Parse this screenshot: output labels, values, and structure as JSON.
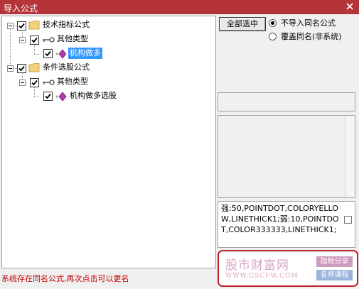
{
  "window": {
    "title": "导入公式"
  },
  "tree": {
    "items": [
      {
        "label": "技术指标公式"
      },
      {
        "label": "其他类型"
      },
      {
        "label": "机构做多"
      },
      {
        "label": "条件选股公式"
      },
      {
        "label": "其他类型"
      },
      {
        "label": "机构做多选股"
      }
    ]
  },
  "options": {
    "select_all_label": "全部选中",
    "radio": [
      {
        "label": "不导入同名公式",
        "checked": true
      },
      {
        "label": "覆盖同名(非系统)",
        "checked": false
      }
    ]
  },
  "code": {
    "text": "强:50,POINTDOT,COLORYELLOW,LINETHICK1;弱:10,POINTDOT,COLOR333333,LINETHICK1;"
  },
  "watermark": {
    "main": "股市财富网",
    "url": "WWW.GSCFW.COM",
    "tag1": "指标分享",
    "tag2": "名师课程"
  },
  "status": {
    "message": "系统存在同名公式,再次点击可以更名"
  },
  "colors": {
    "titlebar": "#b5343a",
    "selection": "#3399ff",
    "status_text": "#c00000",
    "watermark_border": "#c0202a"
  }
}
